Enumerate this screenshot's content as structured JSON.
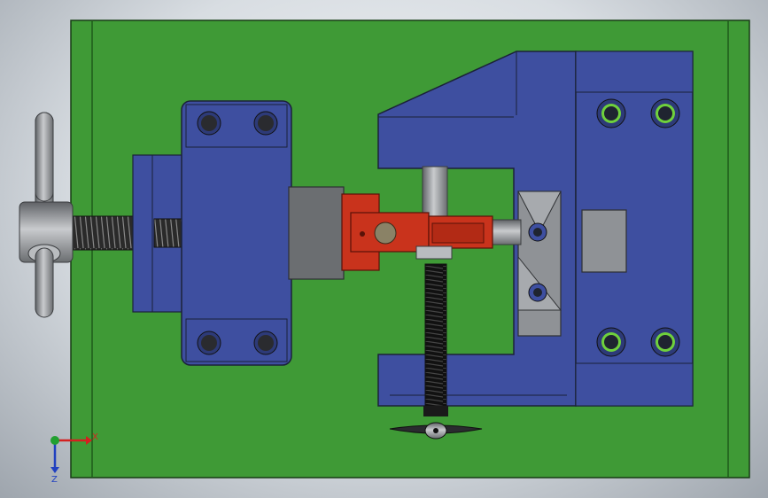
{
  "app": {
    "view_title": ""
  },
  "colors": {
    "baseplate": "#3f9a36",
    "body_blue": "#3e4fa0",
    "edge": "#1b2238",
    "steel_gray": "#8f9296",
    "dark_gray": "#6b6e71",
    "workpiece_red": "#c9331c",
    "screw_black": "#1a1a1a",
    "insert_green": "#6fd13c",
    "axis_x": "#d42020",
    "axis_y": "#22a030",
    "axis_z": "#2040c0"
  },
  "triad": {
    "x_label": "X",
    "z_label": "Z"
  },
  "icons": {
    "triad": "coordinate-triad-icon",
    "t_handle_left": "t-handle-icon",
    "star_knob_bottom": "star-knob-icon"
  }
}
